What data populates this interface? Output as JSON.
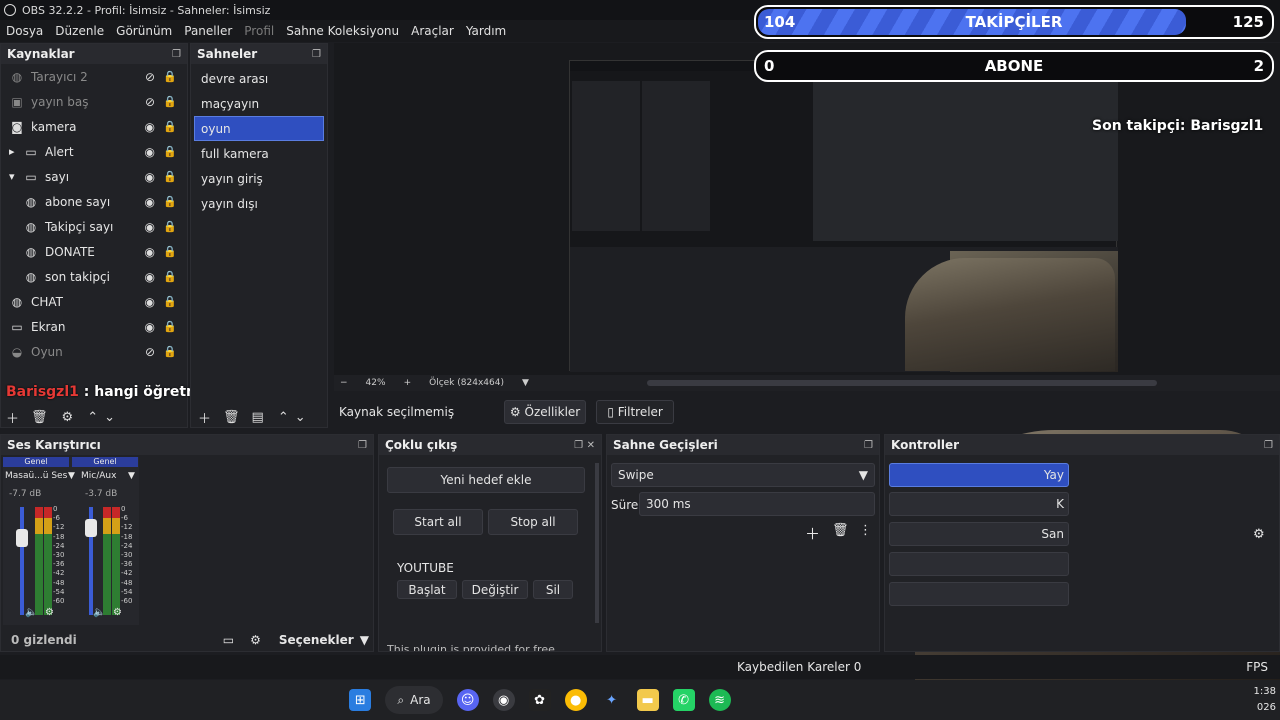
{
  "titlebar": {
    "title": "OBS 32.2.2 - Profil: İsimsiz - Sahneler: İsimsiz"
  },
  "menu": [
    "Dosya",
    "Düzenle",
    "Görünüm",
    "Paneller",
    "Profil",
    "Sahne Koleksiyonu",
    "Araçlar",
    "Yardım"
  ],
  "sources": {
    "title": "Kaynaklar",
    "items": [
      {
        "label": "Tarayıcı 2",
        "icon": "globe-icon",
        "dim": true
      },
      {
        "label": "yayın baş",
        "icon": "image-icon",
        "dim": true
      },
      {
        "label": "kamera",
        "icon": "camera-icon",
        "dim": false
      },
      {
        "label": "Alert",
        "icon": "folder-icon",
        "dim": false
      },
      {
        "label": "sayı",
        "icon": "folder-icon",
        "dim": false
      },
      {
        "label": "abone sayı",
        "icon": "globe-icon",
        "dim": false
      },
      {
        "label": "Takipçi sayı",
        "icon": "globe-icon",
        "dim": false
      },
      {
        "label": "DONATE",
        "icon": "globe-icon",
        "dim": false
      },
      {
        "label": "son takipçi",
        "icon": "globe-icon",
        "dim": false
      },
      {
        "label": "CHAT",
        "icon": "globe-icon",
        "dim": false
      },
      {
        "label": "Ekran",
        "icon": "monitor-icon",
        "dim": false
      },
      {
        "label": "Oyun",
        "icon": "gamepad-icon",
        "dim": true
      }
    ]
  },
  "chat": {
    "user": "Barisgzl1",
    "message": " : hangi öğretmenlik"
  },
  "scenes": {
    "title": "Sahneler",
    "items": [
      "devre arası",
      "maçyayın",
      "oyun",
      "full kamera",
      "yayın giriş",
      "yayın dışı"
    ],
    "selected_index": 2
  },
  "overlay": {
    "followers": {
      "left": "104",
      "label": "TAKİPÇİLER",
      "right": "125",
      "progress": 0.83
    },
    "subs": {
      "left": "0",
      "label": "ABONE",
      "right": "2",
      "progress": 0
    },
    "last_follower": "Son takipçi: Barisgzl1"
  },
  "zoom": {
    "minus": "−",
    "level": "42%",
    "plus": "+",
    "scale": "Ölçek (824x464)"
  },
  "props": {
    "no_source": "Kaynak seçilmemiş",
    "properties": "Özellikler",
    "filters": "Filtreler"
  },
  "mixer": {
    "title": "Ses Karıştırıcı",
    "channels": [
      {
        "tag": "Genel",
        "name": "Masaü...ü Ses",
        "db": "-7.7 dB"
      },
      {
        "tag": "Genel",
        "name": "Mic/Aux",
        "db": "-3.7 dB"
      }
    ],
    "scale": [
      "0",
      "-6",
      "-12",
      "-18",
      "-24",
      "-30",
      "-36",
      "-42",
      "-48",
      "-54",
      "-60"
    ],
    "hidden": "0 gizlendi",
    "options": "Seçenekler"
  },
  "multi": {
    "title": "Çoklu çıkış",
    "add": "Yeni hedef ekle",
    "start_all": "Start all",
    "stop_all": "Stop all",
    "target": "YOUTUBE",
    "start": "Başlat",
    "change": "Değiştir",
    "delete": "Sil",
    "footer": "This plugin is provided for free"
  },
  "transitions": {
    "title": "Sahne Geçişleri",
    "type": "Swipe",
    "duration_label": "Süre",
    "duration": "300 ms"
  },
  "controls": {
    "title": "Kontroller",
    "b1": "Yay",
    "b2": "K",
    "b3": "San"
  },
  "status": {
    "dropped": "Kaybedilen Kareler 0",
    "fps": "FPS"
  },
  "taskbar": {
    "search": "Ara",
    "time": "1:38",
    "date": "026"
  }
}
